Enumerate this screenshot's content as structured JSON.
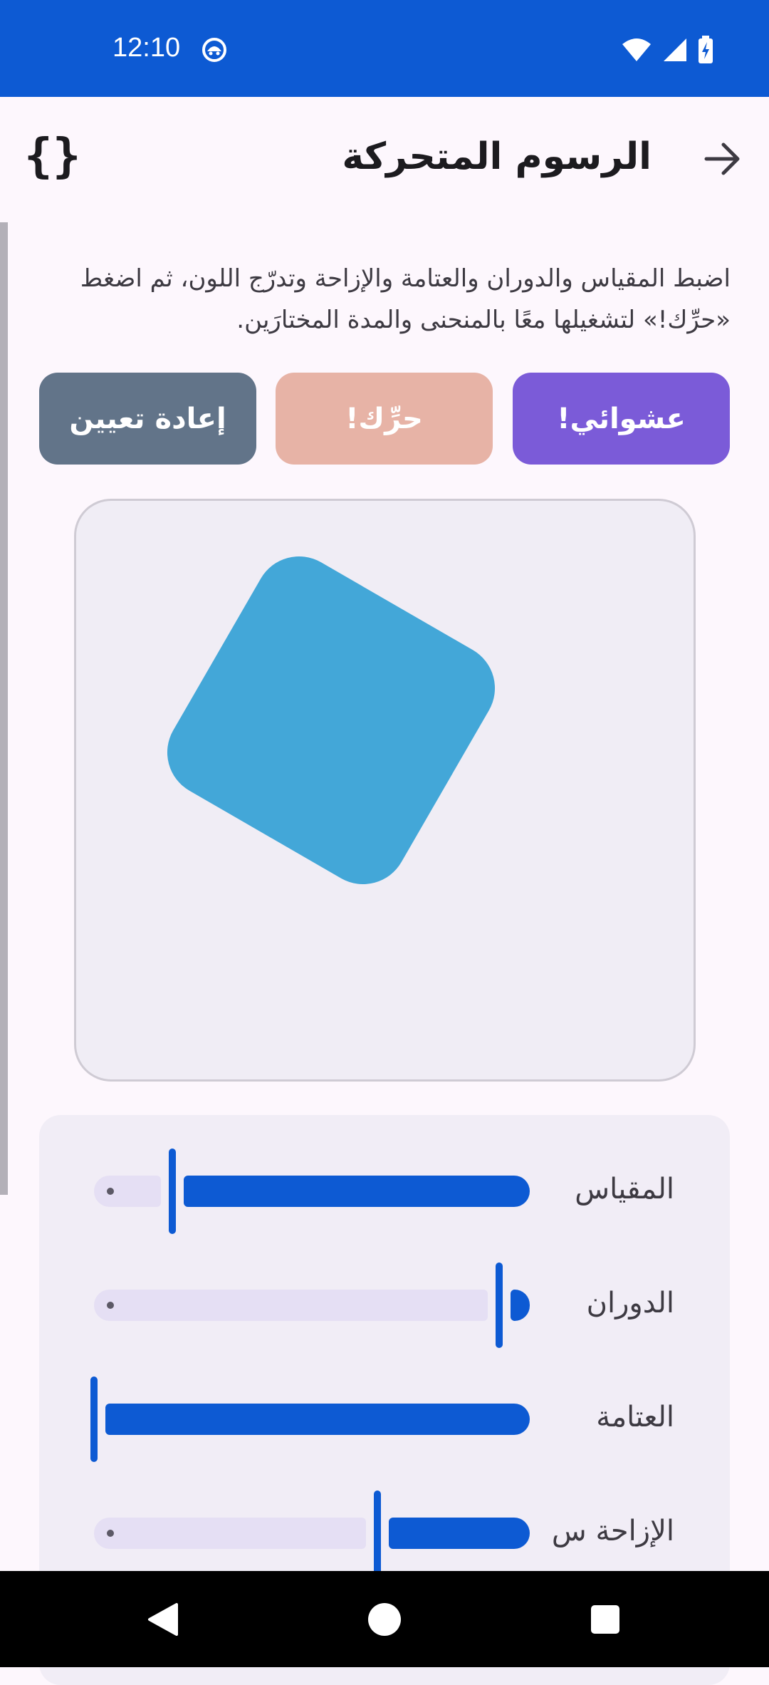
{
  "status_bar": {
    "time": "12:10",
    "app_icon": "android-face-icon",
    "wifi_icon": "wifi-icon",
    "signal_icon": "cell-signal-icon",
    "battery_icon": "battery-charging-icon",
    "background": "#0d5ad3"
  },
  "app_bar": {
    "title": "الرسوم المتحركة",
    "back_icon": "arrow-forward-icon",
    "code_icon": "curly-braces-icon",
    "code_glyph": "{}"
  },
  "description": "اضبط المقياس والدوران والعتامة والإزاحة وتدرّج اللون، ثم اضغط «حرِّك!» لتشغيلها معًا بالمنحنى والمدة المختارَين.",
  "buttons": {
    "random": {
      "label": "عشوائي!",
      "color": "#7b5bd8"
    },
    "animate": {
      "label": "حرِّك!",
      "color": "#e7b3a6"
    },
    "reset": {
      "label": "إعادة تعيين",
      "color": "#627489"
    }
  },
  "preview": {
    "shape_color": "#43a7d8",
    "rotation_deg": 30
  },
  "sliders": [
    {
      "label": "المقياس",
      "value_fraction": 0.82
    },
    {
      "label": "الدوران",
      "value_fraction": 0.07
    },
    {
      "label": "العتامة",
      "value_fraction": 1.0
    },
    {
      "label": "الإزاحة س",
      "value_fraction": 0.35
    }
  ],
  "nav_bar": {
    "back_icon": "nav-back-triangle-icon",
    "home_icon": "nav-home-circle-icon",
    "recents_icon": "nav-recents-square-icon"
  }
}
